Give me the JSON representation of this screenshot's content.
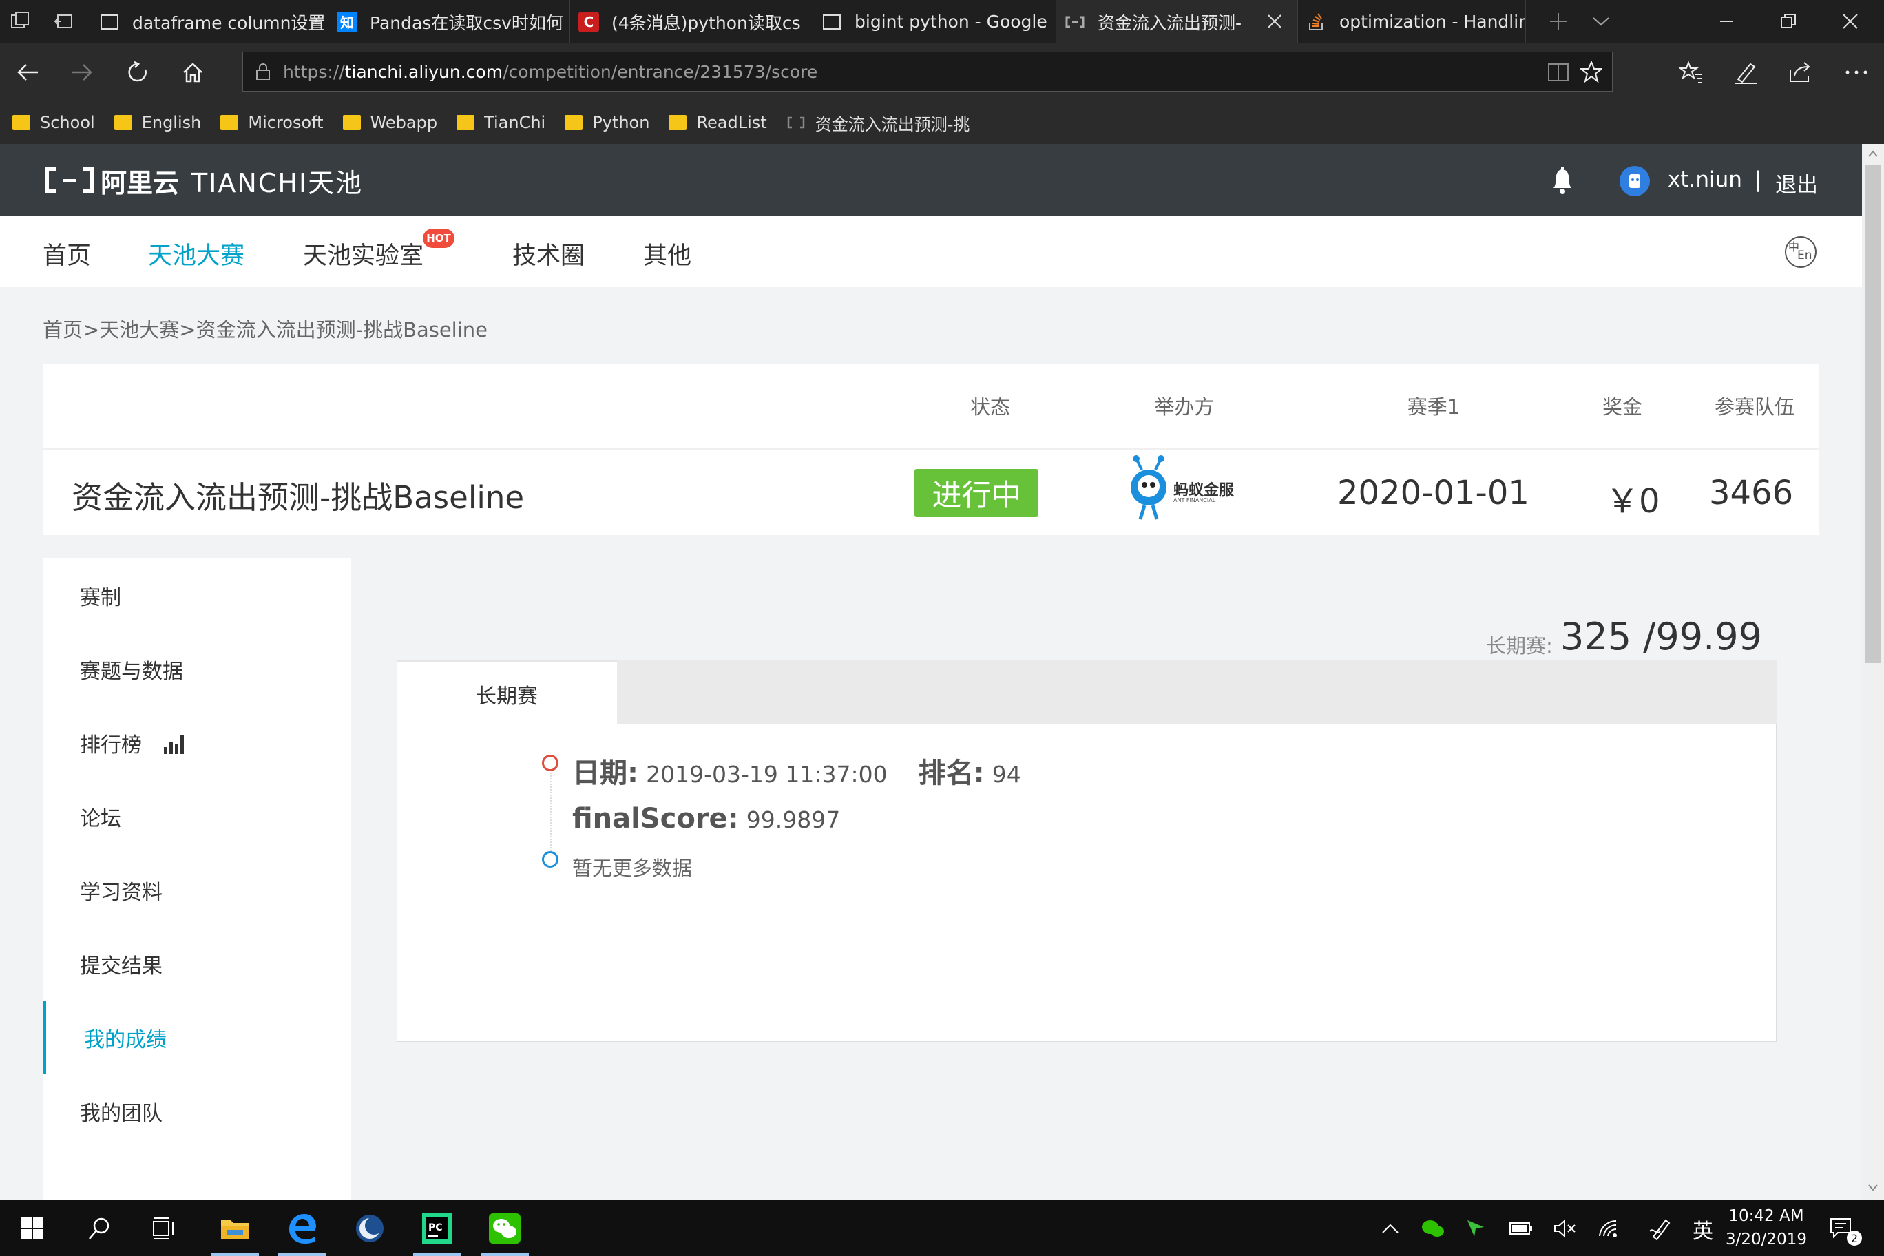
{
  "browser": {
    "tabs": [
      {
        "title": "dataframe column设置",
        "icon": "page-icon"
      },
      {
        "title": "Pandas在读取csv时如何",
        "icon": "zhihu-icon",
        "icon_text": "知"
      },
      {
        "title": "(4条消息)python读取cs",
        "icon": "csdn-icon",
        "icon_text": "C"
      },
      {
        "title": "bigint python - Google",
        "icon": "page-icon"
      },
      {
        "title": "资金流入流出预测-",
        "icon": "aliyun-icon"
      },
      {
        "title": "optimization - Handling",
        "icon": "stackoverflow-icon"
      }
    ],
    "url_prefix": "https://",
    "url_host": "tianchi.aliyun.com",
    "url_path": "/competition/entrance/231573/score",
    "favorites": [
      "School",
      "English",
      "Microsoft",
      "Webapp",
      "TianChi",
      "Python",
      "ReadList"
    ],
    "favorite_page": "资金流入流出预测-挑"
  },
  "site": {
    "brand_cn": "阿里云",
    "brand_en": "TIANCHI天池",
    "username": "xt.niun",
    "logout": "退出",
    "separator": "|",
    "nav": [
      "首页",
      "天池大赛",
      "天池实验室",
      "技术圈",
      "其他"
    ],
    "hot_badge": "HOT",
    "lang_label": "En",
    "lang_cn": "中"
  },
  "breadcrumb": "首页>天池大赛>资金流入流出预测-挑战Baseline",
  "competition": {
    "headers": {
      "status": "状态",
      "organizer": "举办方",
      "season": "赛季1",
      "prize": "奖金",
      "teams": "参赛队伍"
    },
    "title": "资金流入流出预测-挑战Baseline",
    "status": "进行中",
    "organizer_logo_text": "蚂蚁金服",
    "organizer_logo_sub": "ANT FINANCIAL",
    "season": "2020-01-01",
    "prize": "￥0",
    "teams": "3466"
  },
  "sidebar": [
    "赛制",
    "赛题与数据",
    "排行榜",
    "论坛",
    "学习资料",
    "提交结果",
    "我的成绩",
    "我的团队"
  ],
  "score": {
    "summary_label": "长期赛:",
    "summary_value": "325 /99.99",
    "tab": "长期赛",
    "date_label": "日期:",
    "date_value": "2019-03-19 11:37:00",
    "rank_label": "排名:",
    "rank_value": "94",
    "final_label": "finalScore:",
    "final_value": "99.9897",
    "no_more": "暂无更多数据"
  },
  "taskbar": {
    "time": "10:42 AM",
    "date": "3/20/2019",
    "ime": "英",
    "notif_count": "2"
  },
  "colors": {
    "accent": "#00a2ca",
    "status_green": "#67c23a",
    "header_dark": "#373d41"
  }
}
